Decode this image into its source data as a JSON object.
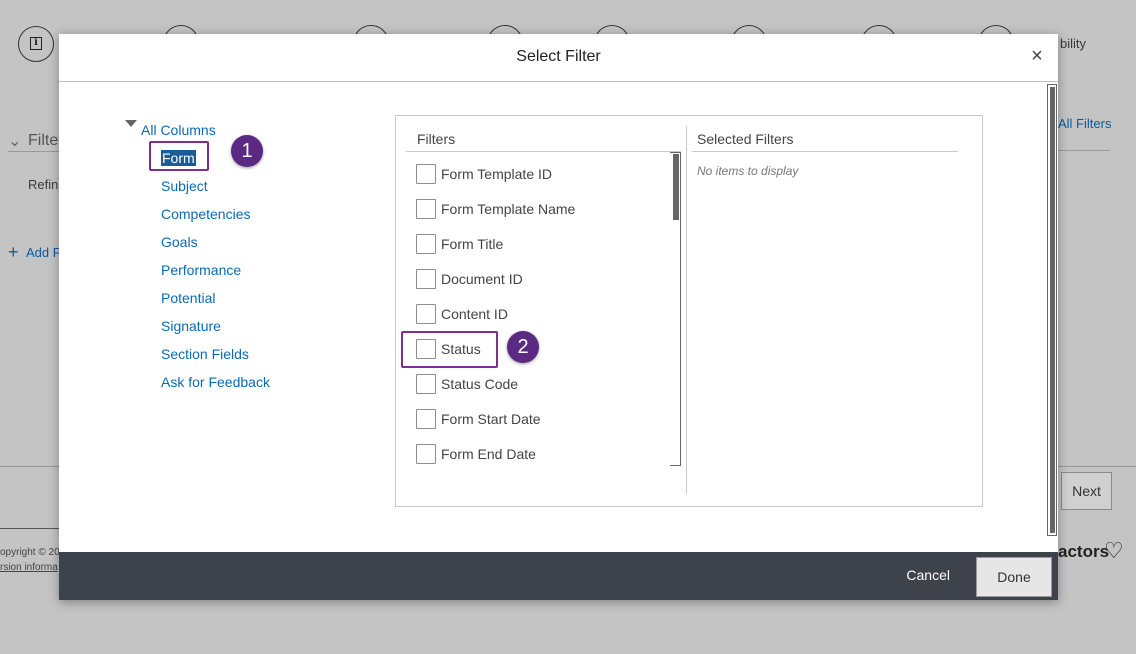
{
  "background": {
    "partial_text_right": "bility",
    "section_partial": "Filte",
    "refine_partial": "Refin",
    "add_partial": "Add F",
    "add_icon": "+",
    "all_filters_partial": "All Filters",
    "next_button": "Next",
    "copyright_partial": "opyright © 20",
    "version_partial": "rsion informa",
    "brand_partial": "actors",
    "heart_icon": "♡"
  },
  "dialog": {
    "title": "Select Filter",
    "close_icon": "×",
    "tree": {
      "root_label": "All Columns",
      "items": [
        {
          "label": "Form",
          "selected": true
        },
        {
          "label": "Subject"
        },
        {
          "label": "Competencies"
        },
        {
          "label": "Goals"
        },
        {
          "label": "Performance"
        },
        {
          "label": "Potential"
        },
        {
          "label": "Signature"
        },
        {
          "label": "Section Fields"
        },
        {
          "label": "Ask for Feedback"
        }
      ]
    },
    "filters_header": "Filters",
    "selected_header": "Selected Filters",
    "no_items": "No items to display",
    "filters": [
      {
        "label": "Form Template ID",
        "checked": false
      },
      {
        "label": "Form Template Name",
        "checked": false
      },
      {
        "label": "Form Title",
        "checked": false
      },
      {
        "label": "Document ID",
        "checked": false
      },
      {
        "label": "Content ID",
        "checked": false
      },
      {
        "label": "Status",
        "checked": false
      },
      {
        "label": "Status Code",
        "checked": false
      },
      {
        "label": "Form Start Date",
        "checked": false
      },
      {
        "label": "Form End Date",
        "checked": false
      }
    ],
    "badges": [
      "1",
      "2"
    ],
    "cancel_label": "Cancel",
    "done_label": "Done"
  }
}
